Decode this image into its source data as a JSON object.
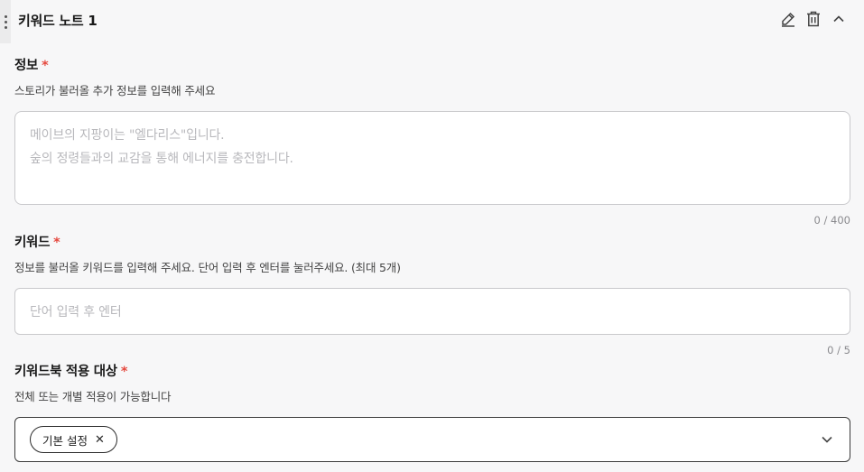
{
  "note": {
    "title": "키워드 노트 1",
    "actions": [
      "pencil-icon",
      "trash-icon",
      "chevron-up-icon"
    ]
  },
  "info": {
    "label": "정보",
    "required_mark": "*",
    "description": "스토리가 불러올 추가 정보를 입력해 주세요",
    "placeholder_line1": "메이브의 지팡이는 \"엘다리스\"입니다.",
    "placeholder_line2": "숲의 정령들과의 교감을 통해 에너지를 충전합니다.",
    "counter": "0 / 400"
  },
  "keyword": {
    "label": "키워드",
    "required_mark": "*",
    "description": "정보를 불러올 키워드를 입력해 주세요. 단어 입력 후 엔터를 눌러주세요. (최대 5개)",
    "placeholder": "단어 입력 후 엔터",
    "counter": "0 / 5"
  },
  "target": {
    "label": "키워드북 적용 대상",
    "required_mark": "*",
    "description": "전체 또는 개별 적용이 가능합니다",
    "selected_chip": "기본 설정",
    "chip_remove": "✕"
  },
  "colors": {
    "required": "#e5483e",
    "border": "#c9c9cc",
    "placeholder": "#b8b8bc",
    "background": "#f7f7f8"
  }
}
